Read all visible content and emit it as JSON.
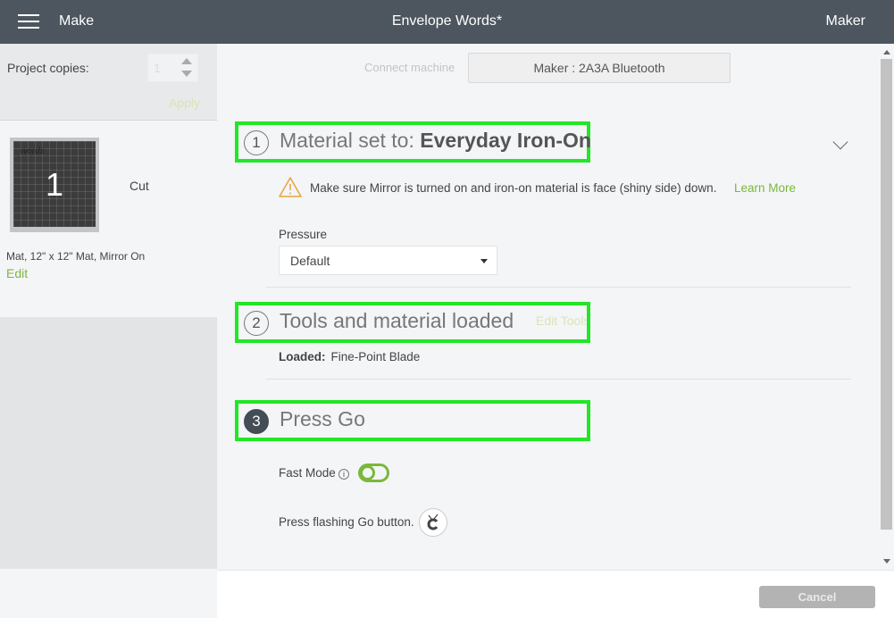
{
  "header": {
    "menu_icon": "hamburger-icon",
    "section": "Make",
    "title": "Envelope Words*",
    "machine": "Maker"
  },
  "sidebar": {
    "copies_label": "Project copies:",
    "copies_value": "1",
    "apply_label": "Apply",
    "mat": {
      "number": "1",
      "design_text": "words",
      "action": "Cut",
      "description": "Mat, 12\" x 12\" Mat, Mirror On",
      "edit_label": "Edit"
    }
  },
  "main": {
    "connect_label": "Connect machine",
    "machine_button": "Maker : 2A3A Bluetooth",
    "steps": [
      {
        "number": "1",
        "title_prefix": "Material set to: ",
        "title_bold": "Everyday Iron-On",
        "warning_icon": "warning-triangle-icon",
        "warning_text": "Make sure Mirror is turned on and iron-on material is face (shiny side) down.",
        "learn_more": "Learn More",
        "pressure_label": "Pressure",
        "pressure_value": "Default"
      },
      {
        "number": "2",
        "title": "Tools and material loaded",
        "edit_tools": "Edit Tools",
        "loaded_label": "Loaded:",
        "loaded_value": "Fine-Point Blade"
      },
      {
        "number": "3",
        "title": "Press Go",
        "fast_mode_label": "Fast Mode",
        "fast_mode_on": false,
        "press_go_text": "Press flashing Go button."
      }
    ]
  },
  "footer": {
    "cancel_label": "Cancel"
  },
  "colors": {
    "accent_green": "#7ab83c",
    "highlight_box": "#22e626",
    "topbar": "#4d565f"
  }
}
